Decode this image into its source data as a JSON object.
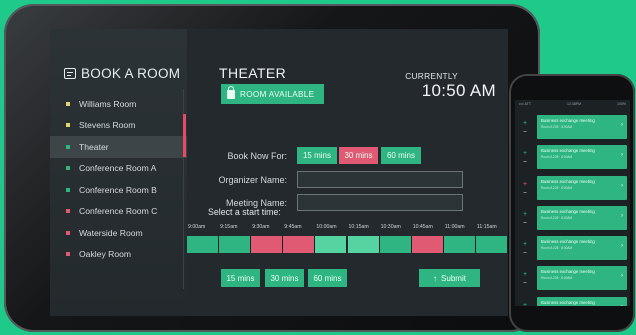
{
  "sidebar": {
    "brand": "BOOK A ROOM",
    "rooms": [
      {
        "label": "Williams Room",
        "color": "#e6d36a"
      },
      {
        "label": "Stevens Room",
        "color": "#e6d36a"
      },
      {
        "label": "Theater",
        "color": "#2fb581"
      },
      {
        "label": "Conference Room A",
        "color": "#2fb581"
      },
      {
        "label": "Conference Room B",
        "color": "#2fb581"
      },
      {
        "label": "Conference Room C",
        "color": "#e05a73"
      },
      {
        "label": "Waterside Room",
        "color": "#e05a73"
      },
      {
        "label": "Oakley Room",
        "color": "#e05a73"
      }
    ],
    "active_index": 2
  },
  "main": {
    "room_title": "THEATER",
    "status": "ROOM AVAILABLE",
    "currently_label": "CURRENTLY",
    "time": "10:50 AM",
    "book_now_label": "Book Now For:",
    "book_options": [
      {
        "label": "15 mins",
        "state": "green"
      },
      {
        "label": "30 mins",
        "state": "red"
      },
      {
        "label": "60 mins",
        "state": "green"
      }
    ],
    "organizer_label": "Organizer Name:",
    "meeting_label": "Meeting Name:",
    "start_label": "Select a start time:",
    "times": [
      "9:00am",
      "9:15am",
      "9:30am",
      "9:45am",
      "10:00am",
      "10:15am",
      "10:30am",
      "10:45am",
      "11:00am",
      "11:15am"
    ],
    "slots": [
      "#2fb581",
      "#2fb581",
      "#e05a73",
      "#e05a73",
      "#55d4a2",
      "#55d4a2",
      "#2fb581",
      "#e05a73",
      "#2fb581",
      "#2fb581"
    ],
    "duration_buttons": [
      "15 mins",
      "30 mins",
      "60 mins"
    ],
    "submit_label": "Submit",
    "colors": {
      "green": "#2fb581",
      "red": "#e05a73",
      "light_green": "#55d4a2"
    }
  },
  "phone": {
    "carrier": "•••• ATT",
    "clock": "12:38PM",
    "battery": "100%",
    "meetings": [
      {
        "title": "Business exchange meeting",
        "sub": "Room A 228 · 8:00AM",
        "accent": "green"
      },
      {
        "title": "Business exchange meeting",
        "sub": "Room A 228 · 8:00AM",
        "accent": "green"
      },
      {
        "title": "Business exchange meeting",
        "sub": "Room A 228 · 8:00AM",
        "accent": "red"
      },
      {
        "title": "Business exchange meeting",
        "sub": "Room A 228 · 8:00AM",
        "accent": "green"
      },
      {
        "title": "Business exchange meeting",
        "sub": "Room A 228 · 8:00AM",
        "accent": "green"
      },
      {
        "title": "Business exchange meeting",
        "sub": "Room A 228 · 8:00AM",
        "accent": "green"
      },
      {
        "title": "Business exchange meeting",
        "sub": "Room A 228 · 8:00AM",
        "accent": "green"
      }
    ]
  }
}
